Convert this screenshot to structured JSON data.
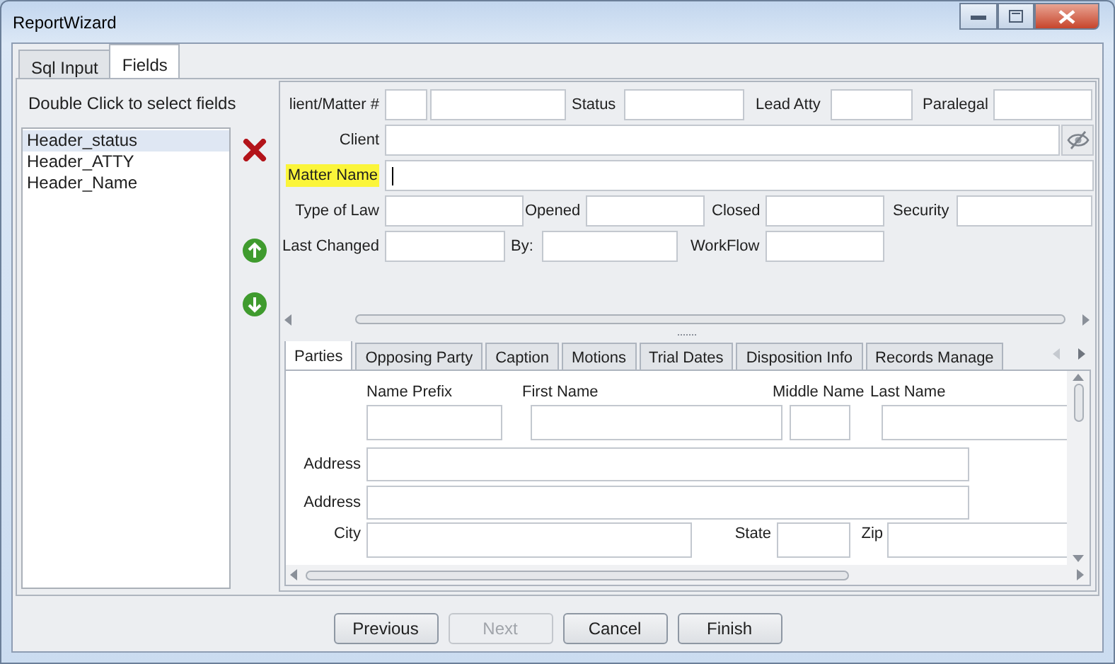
{
  "window": {
    "title": "ReportWizard"
  },
  "tabs": [
    {
      "label": "Sql Input",
      "selected": false
    },
    {
      "label": "Fields",
      "selected": true
    }
  ],
  "field_picker": {
    "instruction": "Double Click to select fields",
    "items": [
      {
        "label": "Header_status",
        "selected": true
      },
      {
        "label": "Header_ATTY",
        "selected": false
      },
      {
        "label": "Header_Name",
        "selected": false
      }
    ]
  },
  "header_form": {
    "rows": [
      [
        {
          "kind": "label",
          "text": "lient/Matter #"
        },
        {
          "kind": "field"
        },
        {
          "kind": "field"
        },
        {
          "kind": "label",
          "text": "Status"
        },
        {
          "kind": "field"
        },
        {
          "kind": "label",
          "text": "Lead Atty"
        },
        {
          "kind": "field"
        },
        {
          "kind": "label",
          "text": "Paralegal"
        },
        {
          "kind": "field"
        }
      ],
      [
        {
          "kind": "label",
          "text": "Client"
        },
        {
          "kind": "field"
        },
        {
          "kind": "lookup"
        }
      ],
      [
        {
          "kind": "label",
          "text": "Matter Name",
          "highlighted": true
        },
        {
          "kind": "field",
          "focused": true
        }
      ],
      [
        {
          "kind": "label",
          "text": "Type of Law"
        },
        {
          "kind": "field"
        },
        {
          "kind": "label",
          "text": "Opened"
        },
        {
          "kind": "field"
        },
        {
          "kind": "label",
          "text": "Closed"
        },
        {
          "kind": "field"
        },
        {
          "kind": "label",
          "text": "Security"
        },
        {
          "kind": "field"
        }
      ],
      [
        {
          "kind": "label",
          "text": "Last Changed"
        },
        {
          "kind": "field"
        },
        {
          "kind": "label",
          "text": "By:"
        },
        {
          "kind": "field"
        },
        {
          "kind": "label",
          "text": "WorkFlow"
        },
        {
          "kind": "field"
        }
      ]
    ]
  },
  "detail_tabs": [
    {
      "label": "Parties",
      "selected": true
    },
    {
      "label": "Opposing Party",
      "selected": false
    },
    {
      "label": "Caption",
      "selected": false
    },
    {
      "label": "Motions",
      "selected": false
    },
    {
      "label": "Trial Dates",
      "selected": false
    },
    {
      "label": "Disposition Info",
      "selected": false
    },
    {
      "label": "Records Manage",
      "selected": false
    }
  ],
  "parties_form": {
    "name_columns": [
      {
        "label": "Name Prefix"
      },
      {
        "label": "First Name"
      },
      {
        "label": "Middle Name"
      },
      {
        "label": "Last Name"
      }
    ],
    "address_lines": [
      {
        "label": "Address"
      },
      {
        "label": "Address"
      }
    ],
    "locality": [
      {
        "label": "City"
      },
      {
        "label": "State"
      },
      {
        "label": "Zip"
      }
    ]
  },
  "buttons": [
    {
      "label": "Previous",
      "disabled": false
    },
    {
      "label": "Next",
      "disabled": true
    },
    {
      "label": "Cancel",
      "disabled": false
    },
    {
      "label": "Finish",
      "disabled": false
    }
  ]
}
